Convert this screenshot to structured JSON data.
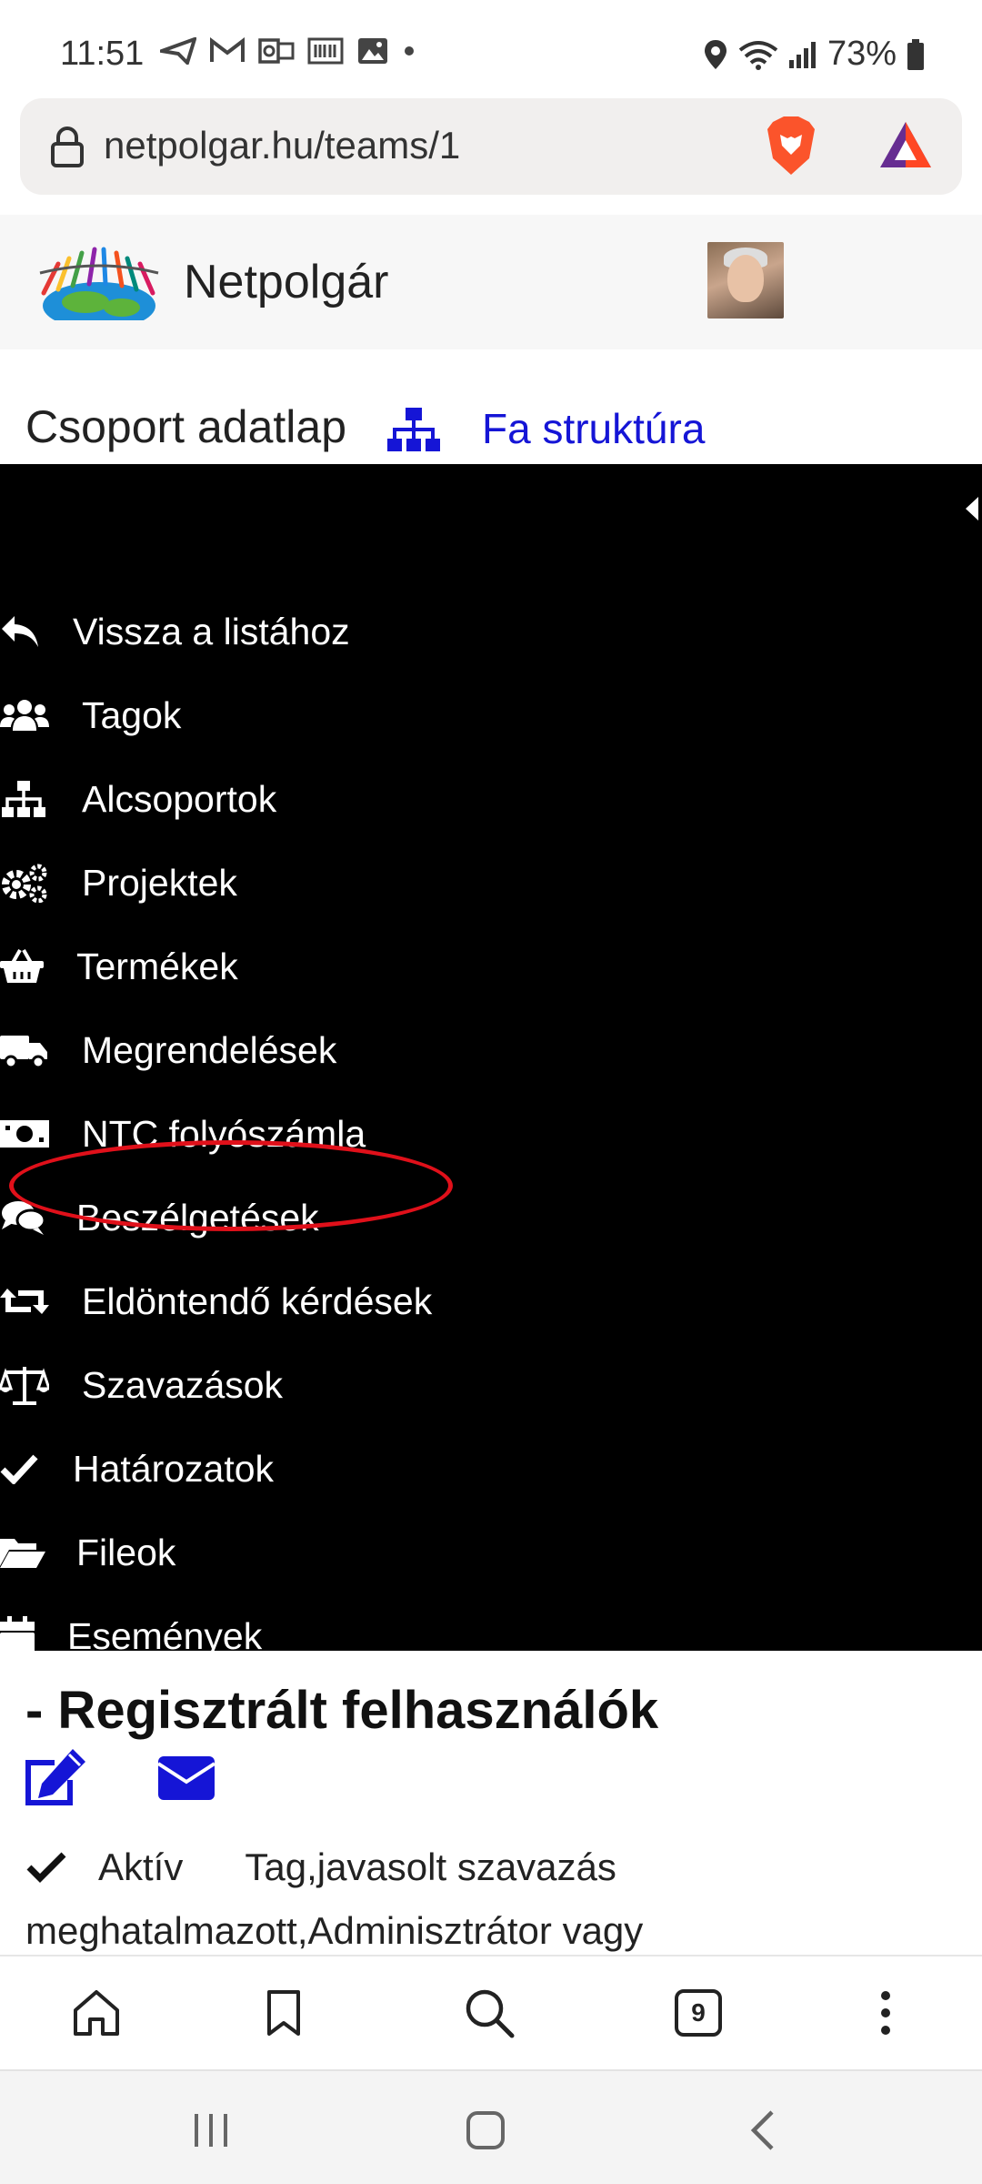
{
  "status_bar": {
    "time": "11:51",
    "battery": "73%",
    "icons_left": [
      "send-icon",
      "gmail-icon",
      "outlook-icon",
      "barcode-icon",
      "image-icon",
      "dot-icon"
    ],
    "icons_right": [
      "location-icon",
      "wifi-icon",
      "signal-icon",
      "battery-icon"
    ]
  },
  "browser": {
    "url": "netpolgar.hu/teams/1",
    "tab_count": "9"
  },
  "site": {
    "name": "Netpolgár"
  },
  "page": {
    "title": "Csoport adatlap",
    "tree_link": "Fa struktúra"
  },
  "menu": {
    "items": [
      {
        "label": "Vissza a listához",
        "icon": "reply-icon"
      },
      {
        "label": "Tagok",
        "icon": "users-icon"
      },
      {
        "label": "Alcsoportok",
        "icon": "sitemap-icon"
      },
      {
        "label": "Projektek",
        "icon": "cogs-icon"
      },
      {
        "label": "Termékek",
        "icon": "basket-icon"
      },
      {
        "label": "Megrendelések",
        "icon": "truck-icon"
      },
      {
        "label": "NTC folyószámla",
        "icon": "money-bill-icon"
      },
      {
        "label": "Beszélgetések",
        "icon": "comments-icon"
      },
      {
        "label": "Eldöntendő kérdések",
        "icon": "retweet-icon"
      },
      {
        "label": "Szavazások",
        "icon": "balance-scale-icon"
      },
      {
        "label": "Határozatok",
        "icon": "check-icon"
      },
      {
        "label": "Fileok",
        "icon": "folder-open-icon"
      },
      {
        "label": "Események",
        "icon": "calendar-icon"
      }
    ]
  },
  "content": {
    "section_title": "- Regisztrált felhasználók",
    "status_label": "Aktív",
    "status_text": "Tag,javasolt szavazás",
    "status_line2": "meghatalmazott,Adminisztrátor vagy"
  },
  "colors": {
    "menu_bg": "#000000",
    "link_blue": "#1515d6",
    "highlight_red": "#e0101a"
  }
}
